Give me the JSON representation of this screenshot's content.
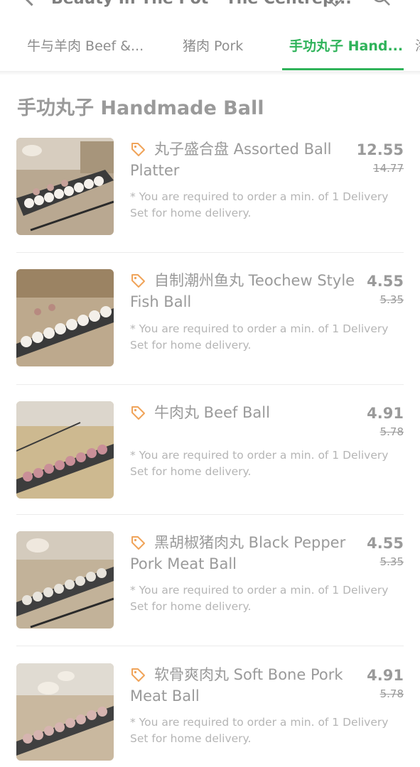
{
  "header": {
    "title": "Beauty In The Pot - The Centrep..."
  },
  "tabs": [
    {
      "label": "牛与羊肉 Beef &..."
    },
    {
      "label": "猪肉 Pork"
    },
    {
      "label": "手功丸子 Hand..."
    },
    {
      "label": "海"
    }
  ],
  "section": {
    "title": "手功丸子 Handmade Ball"
  },
  "items": [
    {
      "name": "丸子盛合盘 Assorted Ball Platter",
      "price": "12.55",
      "old_price": "14.77",
      "note": "* You are required to order a min. of 1 Delivery Set for home delivery."
    },
    {
      "name": "自制潮州鱼丸 Teochew Style Fish Ball",
      "price": "4.55",
      "old_price": "5.35",
      "note": "* You are required to order a min. of 1 Delivery Set for home delivery."
    },
    {
      "name": "牛肉丸 Beef Ball",
      "price": "4.91",
      "old_price": "5.78",
      "note": "* You are required to order a min. of 1 Delivery Set for home delivery."
    },
    {
      "name": "黑胡椒猪肉丸 Black Pepper Pork Meat Ball",
      "price": "4.55",
      "old_price": "5.35",
      "note": "* You are required to order a min. of 1 Delivery Set for home delivery."
    },
    {
      "name": "软骨爽肉丸 Soft Bone Pork Meat Ball",
      "price": "4.91",
      "old_price": "5.78",
      "note": "* You are required to order a min. of 1 Delivery Set for home delivery."
    }
  ],
  "colors": {
    "accent": "#2fb35a",
    "tag_icon": "#f0a45a"
  },
  "icons": {
    "back": "chevron-left-icon",
    "favorite": "heart-icon",
    "search": "search-icon",
    "promo": "tag-icon"
  }
}
